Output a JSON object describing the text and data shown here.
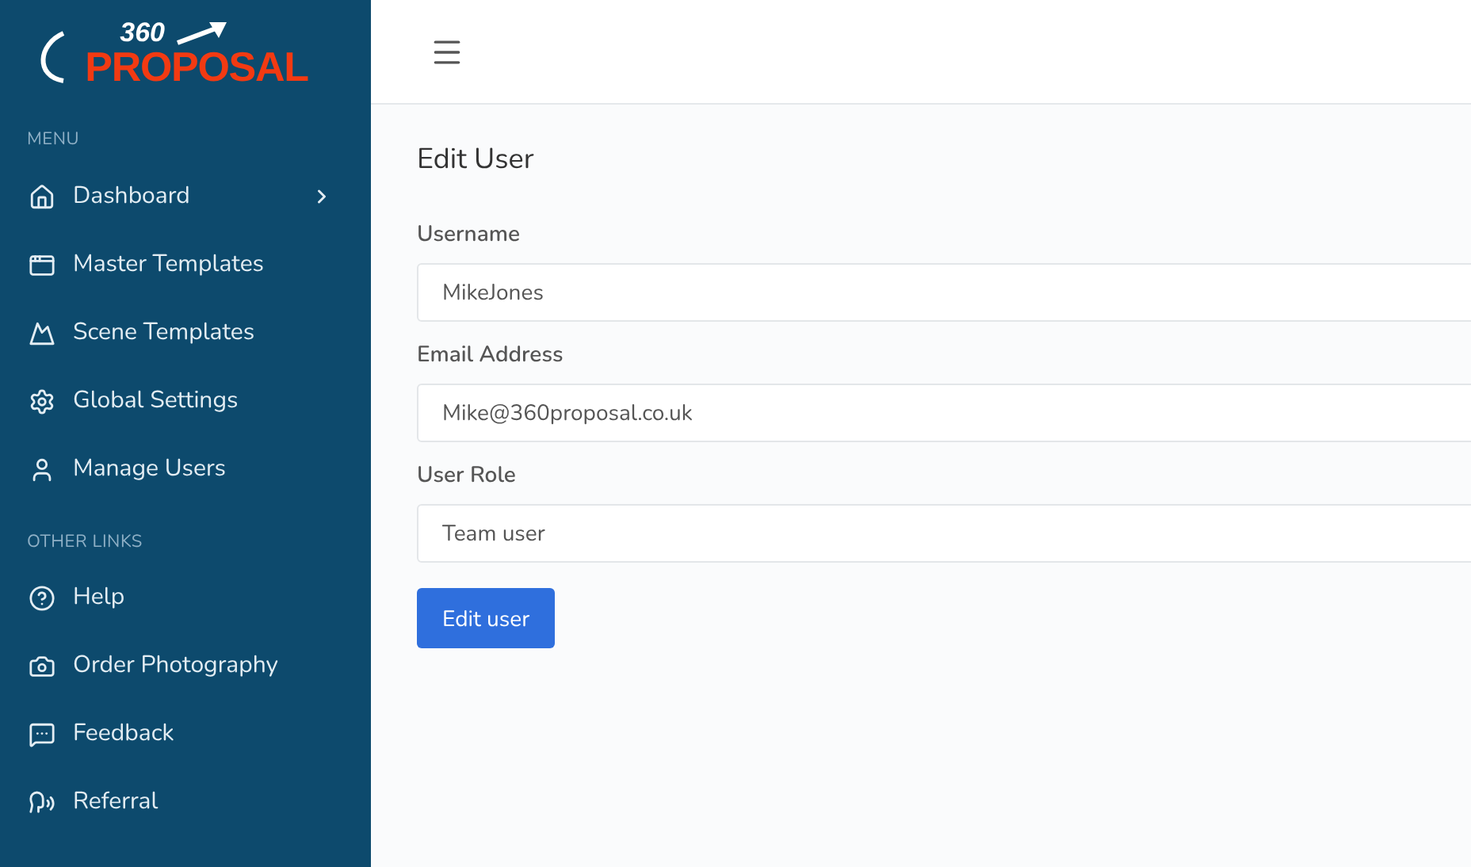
{
  "logo": {
    "number": "360",
    "word": "PROPOSAL"
  },
  "sidebar": {
    "sections": [
      {
        "heading": "MENU",
        "items": [
          {
            "label": "Dashboard",
            "kind": "submenu"
          },
          {
            "label": "Master Templates",
            "kind": "link"
          },
          {
            "label": "Scene Templates",
            "kind": "link"
          },
          {
            "label": "Global Settings",
            "kind": "link"
          },
          {
            "label": "Manage Users",
            "kind": "link"
          }
        ]
      },
      {
        "heading": "OTHER LINKS",
        "items": [
          {
            "label": "Help",
            "kind": "link"
          },
          {
            "label": "Order Photography",
            "kind": "link"
          },
          {
            "label": "Feedback",
            "kind": "link"
          },
          {
            "label": "Referral",
            "kind": "link"
          }
        ]
      }
    ]
  },
  "form": {
    "title": "Edit User",
    "fields": [
      {
        "label": "Username",
        "value": "MikeJones"
      },
      {
        "label": "Email Address",
        "value": "Mike@360proposal.co.uk"
      },
      {
        "label": "User Role",
        "value": "Team user"
      }
    ],
    "submit": "Edit user"
  }
}
